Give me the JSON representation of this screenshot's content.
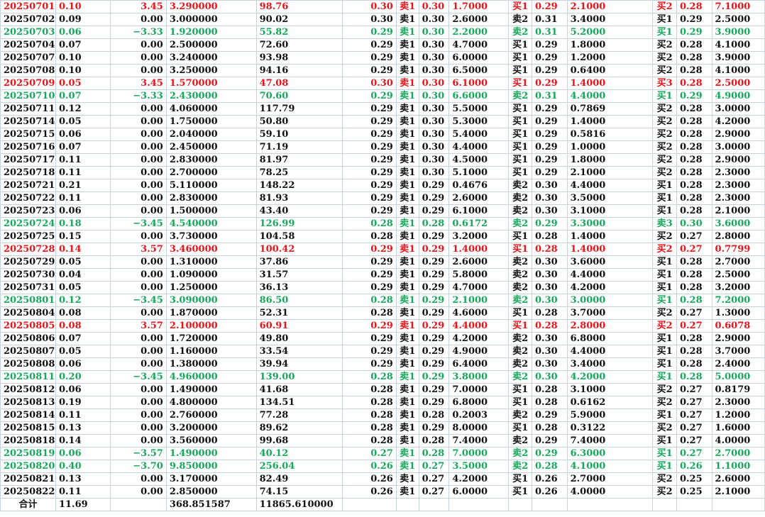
{
  "colors": {
    "up": "#e8141a",
    "down": "#16a85a",
    "flat": "#111111"
  },
  "rows": [
    {
      "c": [
        "20250701",
        "0.10",
        "3.45",
        "3.290000",
        "98.76",
        "0.30",
        "卖1",
        "0.30",
        "1.7000",
        "买1",
        "0.29",
        "2.1000",
        "买2",
        "0.28",
        "7.1000"
      ],
      "t": "red"
    },
    {
      "c": [
        "20250702",
        "0.09",
        "0.00",
        "3.000000",
        "90.02",
        "0.30",
        "卖1",
        "0.30",
        "2.6000",
        "卖2",
        "0.31",
        "3.4000",
        "买1",
        "0.29",
        "2.5000"
      ],
      "t": "black"
    },
    {
      "c": [
        "20250703",
        "0.06",
        "−3.33",
        "1.920000",
        "55.82",
        "0.29",
        "卖1",
        "0.30",
        "2.2000",
        "卖2",
        "0.31",
        "5.2000",
        "买1",
        "0.29",
        "3.9000"
      ],
      "t": "green"
    },
    {
      "c": [
        "20250704",
        "0.07",
        "0.00",
        "2.500000",
        "72.60",
        "0.29",
        "卖1",
        "0.30",
        "4.7000",
        "买1",
        "0.29",
        "1.8000",
        "买2",
        "0.28",
        "4.1000"
      ],
      "t": "black"
    },
    {
      "c": [
        "20250707",
        "0.10",
        "0.00",
        "3.240000",
        "93.98",
        "0.29",
        "卖1",
        "0.30",
        "6.0000",
        "买1",
        "0.29",
        "1.2000",
        "买2",
        "0.28",
        "3.9000"
      ],
      "t": "black"
    },
    {
      "c": [
        "20250708",
        "0.10",
        "0.00",
        "3.250000",
        "94.16",
        "0.29",
        "卖1",
        "0.30",
        "6.5000",
        "买1",
        "0.29",
        "0.6400",
        "买2",
        "0.28",
        "4.1000"
      ],
      "t": "black"
    },
    {
      "c": [
        "20250709",
        "0.05",
        "3.45",
        "1.570000",
        "47.08",
        "0.30",
        "卖1",
        "0.30",
        "6.1000",
        "买1",
        "0.29",
        "1.4000",
        "买3",
        "0.28",
        "2.5000"
      ],
      "t": "red"
    },
    {
      "c": [
        "20250710",
        "0.07",
        "−3.33",
        "2.430000",
        "70.60",
        "0.29",
        "卖1",
        "0.30",
        "6.6000",
        "卖2",
        "0.31",
        "4.4000",
        "买1",
        "0.29",
        "4.9000"
      ],
      "t": "green"
    },
    {
      "c": [
        "20250711",
        "0.12",
        "0.00",
        "4.060000",
        "117.79",
        "0.29",
        "卖1",
        "0.30",
        "5.5000",
        "买1",
        "0.29",
        "0.7869",
        "买2",
        "0.28",
        "3.0000"
      ],
      "t": "black"
    },
    {
      "c": [
        "20250714",
        "0.05",
        "0.00",
        "1.750000",
        "50.80",
        "0.29",
        "卖1",
        "0.30",
        "5.3000",
        "买1",
        "0.29",
        "1.4000",
        "买2",
        "0.28",
        "4.2000"
      ],
      "t": "black"
    },
    {
      "c": [
        "20250715",
        "0.06",
        "0.00",
        "2.040000",
        "59.10",
        "0.29",
        "卖1",
        "0.30",
        "5.4000",
        "买1",
        "0.29",
        "0.5816",
        "买2",
        "0.28",
        "2.9000"
      ],
      "t": "black"
    },
    {
      "c": [
        "20250716",
        "0.07",
        "0.00",
        "2.450000",
        "71.19",
        "0.29",
        "卖1",
        "0.30",
        "4.4000",
        "买1",
        "0.29",
        "1.0000",
        "买2",
        "0.28",
        "3.0000"
      ],
      "t": "black"
    },
    {
      "c": [
        "20250717",
        "0.11",
        "0.00",
        "2.830000",
        "81.97",
        "0.29",
        "卖1",
        "0.30",
        "4.5000",
        "买1",
        "0.29",
        "1.8000",
        "买2",
        "0.28",
        "2.9000"
      ],
      "t": "black"
    },
    {
      "c": [
        "20250718",
        "0.11",
        "0.00",
        "2.700000",
        "78.25",
        "0.29",
        "卖1",
        "0.30",
        "5.1000",
        "买1",
        "0.29",
        "2.1000",
        "买2",
        "0.28",
        "2.3000"
      ],
      "t": "black"
    },
    {
      "c": [
        "20250721",
        "0.21",
        "0.00",
        "5.110000",
        "148.22",
        "0.29",
        "卖1",
        "0.29",
        "0.4676",
        "卖2",
        "0.30",
        "4.4000",
        "买1",
        "0.28",
        "2.3000"
      ],
      "t": "black"
    },
    {
      "c": [
        "20250722",
        "0.11",
        "0.00",
        "2.830000",
        "81.93",
        "0.29",
        "卖1",
        "0.29",
        "2.6000",
        "卖2",
        "0.30",
        "3.5000",
        "买1",
        "0.28",
        "2.3000"
      ],
      "t": "black"
    },
    {
      "c": [
        "20250723",
        "0.06",
        "0.00",
        "1.500000",
        "43.40",
        "0.29",
        "卖1",
        "0.29",
        "6.1000",
        "卖2",
        "0.30",
        "3.1000",
        "买1",
        "0.28",
        "2.1000"
      ],
      "t": "black"
    },
    {
      "c": [
        "20250724",
        "0.18",
        "−3.45",
        "4.540000",
        "126.99",
        "0.28",
        "卖1",
        "0.28",
        "0.6172",
        "卖2",
        "0.29",
        "3.3000",
        "卖3",
        "0.30",
        "3.6000"
      ],
      "t": "green"
    },
    {
      "c": [
        "20250725",
        "0.15",
        "0.00",
        "3.730000",
        "104.58",
        "0.28",
        "卖1",
        "0.29",
        "3.2000",
        "买1",
        "0.28",
        "1.4000",
        "买2",
        "0.27",
        "2.8000"
      ],
      "t": "black"
    },
    {
      "c": [
        "20250728",
        "0.14",
        "3.57",
        "3.460000",
        "100.42",
        "0.29",
        "卖1",
        "0.29",
        "1.4000",
        "买1",
        "0.28",
        "1.4000",
        "买2",
        "0.27",
        "0.7799"
      ],
      "t": "red"
    },
    {
      "c": [
        "20250729",
        "0.05",
        "0.00",
        "1.310000",
        "37.86",
        "0.29",
        "卖1",
        "0.29",
        "2.6000",
        "卖2",
        "0.30",
        "3.6000",
        "买1",
        "0.28",
        "2.7000"
      ],
      "t": "black"
    },
    {
      "c": [
        "20250730",
        "0.04",
        "0.00",
        "1.090000",
        "31.57",
        "0.29",
        "卖1",
        "0.29",
        "5.8000",
        "卖2",
        "0.30",
        "4.4000",
        "买1",
        "0.28",
        "2.5000"
      ],
      "t": "black"
    },
    {
      "c": [
        "20250731",
        "0.05",
        "0.00",
        "1.250000",
        "36.13",
        "0.29",
        "卖1",
        "0.29",
        "4.7000",
        "卖2",
        "0.30",
        "4.2000",
        "买1",
        "0.28",
        "3.2000"
      ],
      "t": "black"
    },
    {
      "c": [
        "20250801",
        "0.12",
        "−3.45",
        "3.090000",
        "86.50",
        "0.28",
        "卖1",
        "0.29",
        "2.1000",
        "卖2",
        "0.30",
        "3.0000",
        "买1",
        "0.28",
        "7.2000"
      ],
      "t": "green"
    },
    {
      "c": [
        "20250804",
        "0.08",
        "0.00",
        "1.870000",
        "52.31",
        "0.28",
        "卖1",
        "0.29",
        "4.6000",
        "买1",
        "0.28",
        "3.7000",
        "买2",
        "0.27",
        "1.3000"
      ],
      "t": "black"
    },
    {
      "c": [
        "20250805",
        "0.08",
        "3.57",
        "2.100000",
        "60.91",
        "0.29",
        "卖1",
        "0.29",
        "4.4000",
        "买1",
        "0.28",
        "2.8000",
        "买2",
        "0.27",
        "0.6078"
      ],
      "t": "red"
    },
    {
      "c": [
        "20250806",
        "0.07",
        "0.00",
        "1.720000",
        "49.80",
        "0.29",
        "卖1",
        "0.29",
        "4.2000",
        "卖2",
        "0.30",
        "6.8000",
        "买1",
        "0.28",
        "2.9000"
      ],
      "t": "black"
    },
    {
      "c": [
        "20250807",
        "0.05",
        "0.00",
        "1.160000",
        "33.54",
        "0.29",
        "卖1",
        "0.29",
        "4.9000",
        "卖2",
        "0.30",
        "4.4000",
        "买1",
        "0.28",
        "3.7000"
      ],
      "t": "black"
    },
    {
      "c": [
        "20250808",
        "0.06",
        "0.00",
        "1.380000",
        "39.94",
        "0.29",
        "卖1",
        "0.29",
        "6.4000",
        "卖2",
        "0.30",
        "3.4000",
        "买1",
        "0.28",
        "2.4000"
      ],
      "t": "black"
    },
    {
      "c": [
        "20250811",
        "0.20",
        "−3.45",
        "4.960000",
        "139.00",
        "0.28",
        "卖1",
        "0.29",
        "3.8000",
        "卖2",
        "0.30",
        "4.2000",
        "买1",
        "0.28",
        "5.0000"
      ],
      "t": "green"
    },
    {
      "c": [
        "20250812",
        "0.06",
        "0.00",
        "1.490000",
        "41.68",
        "0.28",
        "卖1",
        "0.29",
        "7.0000",
        "买1",
        "0.28",
        "3.1000",
        "买2",
        "0.27",
        "0.8179"
      ],
      "t": "black"
    },
    {
      "c": [
        "20250813",
        "0.19",
        "0.00",
        "4.800000",
        "134.51",
        "0.28",
        "卖1",
        "0.29",
        "6.8000",
        "买1",
        "0.28",
        "0.6162",
        "买2",
        "0.27",
        "2.3000"
      ],
      "t": "black"
    },
    {
      "c": [
        "20250814",
        "0.11",
        "0.00",
        "2.760000",
        "77.28",
        "0.28",
        "卖1",
        "0.28",
        "0.2003",
        "卖2",
        "0.29",
        "5.9000",
        "买1",
        "0.27",
        "1.2000"
      ],
      "t": "black"
    },
    {
      "c": [
        "20250815",
        "0.13",
        "0.00",
        "3.200000",
        "89.62",
        "0.28",
        "卖1",
        "0.29",
        "8.0000",
        "买1",
        "0.28",
        "0.3122",
        "买2",
        "0.27",
        "1.6000"
      ],
      "t": "black"
    },
    {
      "c": [
        "20250818",
        "0.14",
        "0.00",
        "3.560000",
        "99.68",
        "0.28",
        "卖1",
        "0.28",
        "7.4000",
        "卖2",
        "0.29",
        "7.4000",
        "买1",
        "0.27",
        "4.0000"
      ],
      "t": "black"
    },
    {
      "c": [
        "20250819",
        "0.06",
        "−3.57",
        "1.490000",
        "40.12",
        "0.27",
        "卖1",
        "0.28",
        "7.0000",
        "卖2",
        "0.29",
        "6.3000",
        "买1",
        "0.27",
        "2.7000"
      ],
      "t": "green"
    },
    {
      "c": [
        "20250820",
        "0.40",
        "−3.70",
        "9.850000",
        "256.04",
        "0.26",
        "卖1",
        "0.27",
        "3.5000",
        "卖2",
        "0.28",
        "4.1000",
        "买1",
        "0.26",
        "1.1000"
      ],
      "t": "green"
    },
    {
      "c": [
        "20250821",
        "0.13",
        "0.00",
        "3.170000",
        "82.49",
        "0.26",
        "卖1",
        "0.27",
        "4.2000",
        "买1",
        "0.26",
        "2.7000",
        "买2",
        "0.25",
        "2.6000"
      ],
      "t": "black"
    },
    {
      "c": [
        "20250822",
        "0.11",
        "0.00",
        "2.850000",
        "74.15",
        "0.26",
        "卖1",
        "0.27",
        "6.0000",
        "买1",
        "0.26",
        "4.0000",
        "买2",
        "0.25",
        "2.1000"
      ],
      "t": "black"
    }
  ],
  "total": {
    "label": "合计",
    "value_a": "11.69",
    "value_b": "368.851587",
    "value_c": "11865.610000"
  }
}
